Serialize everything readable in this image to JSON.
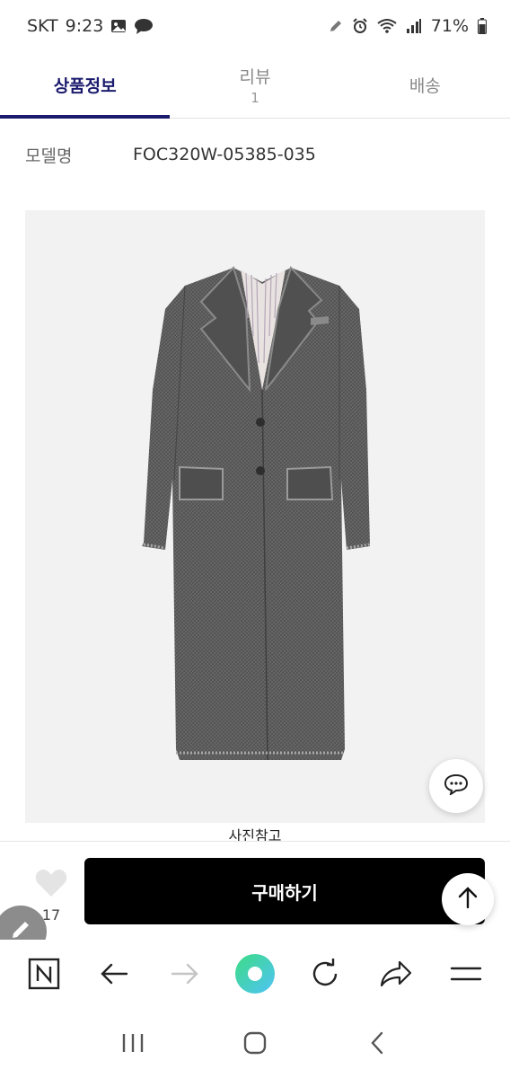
{
  "status_bar": {
    "carrier": "SKT",
    "time": "9:23",
    "battery": "71%",
    "icons_left": [
      "gallery-icon",
      "chat-bubble-icon"
    ],
    "icons_right": [
      "pen-icon",
      "alarm-icon",
      "wifi-icon",
      "signal-icon",
      "battery-icon"
    ]
  },
  "tabs": [
    {
      "label": "상품정보",
      "count": "",
      "active": true
    },
    {
      "label": "리뷰",
      "count": "1",
      "active": false
    },
    {
      "label": "배송",
      "count": "",
      "active": false
    }
  ],
  "model": {
    "label": "모델명",
    "value": "FOC320W-05385-035"
  },
  "product_image": {
    "caption": "사진참고",
    "alt": "coat"
  },
  "purchase_bar": {
    "like_count": "17",
    "buy_label": "구매하기"
  },
  "colors": {
    "accent": "#1b1b6e",
    "buy_button": "#000000",
    "image_bg": "#f2f2f2",
    "refresh_gradient_start": "#3ddc84",
    "refresh_gradient_end": "#4fc3f7"
  }
}
